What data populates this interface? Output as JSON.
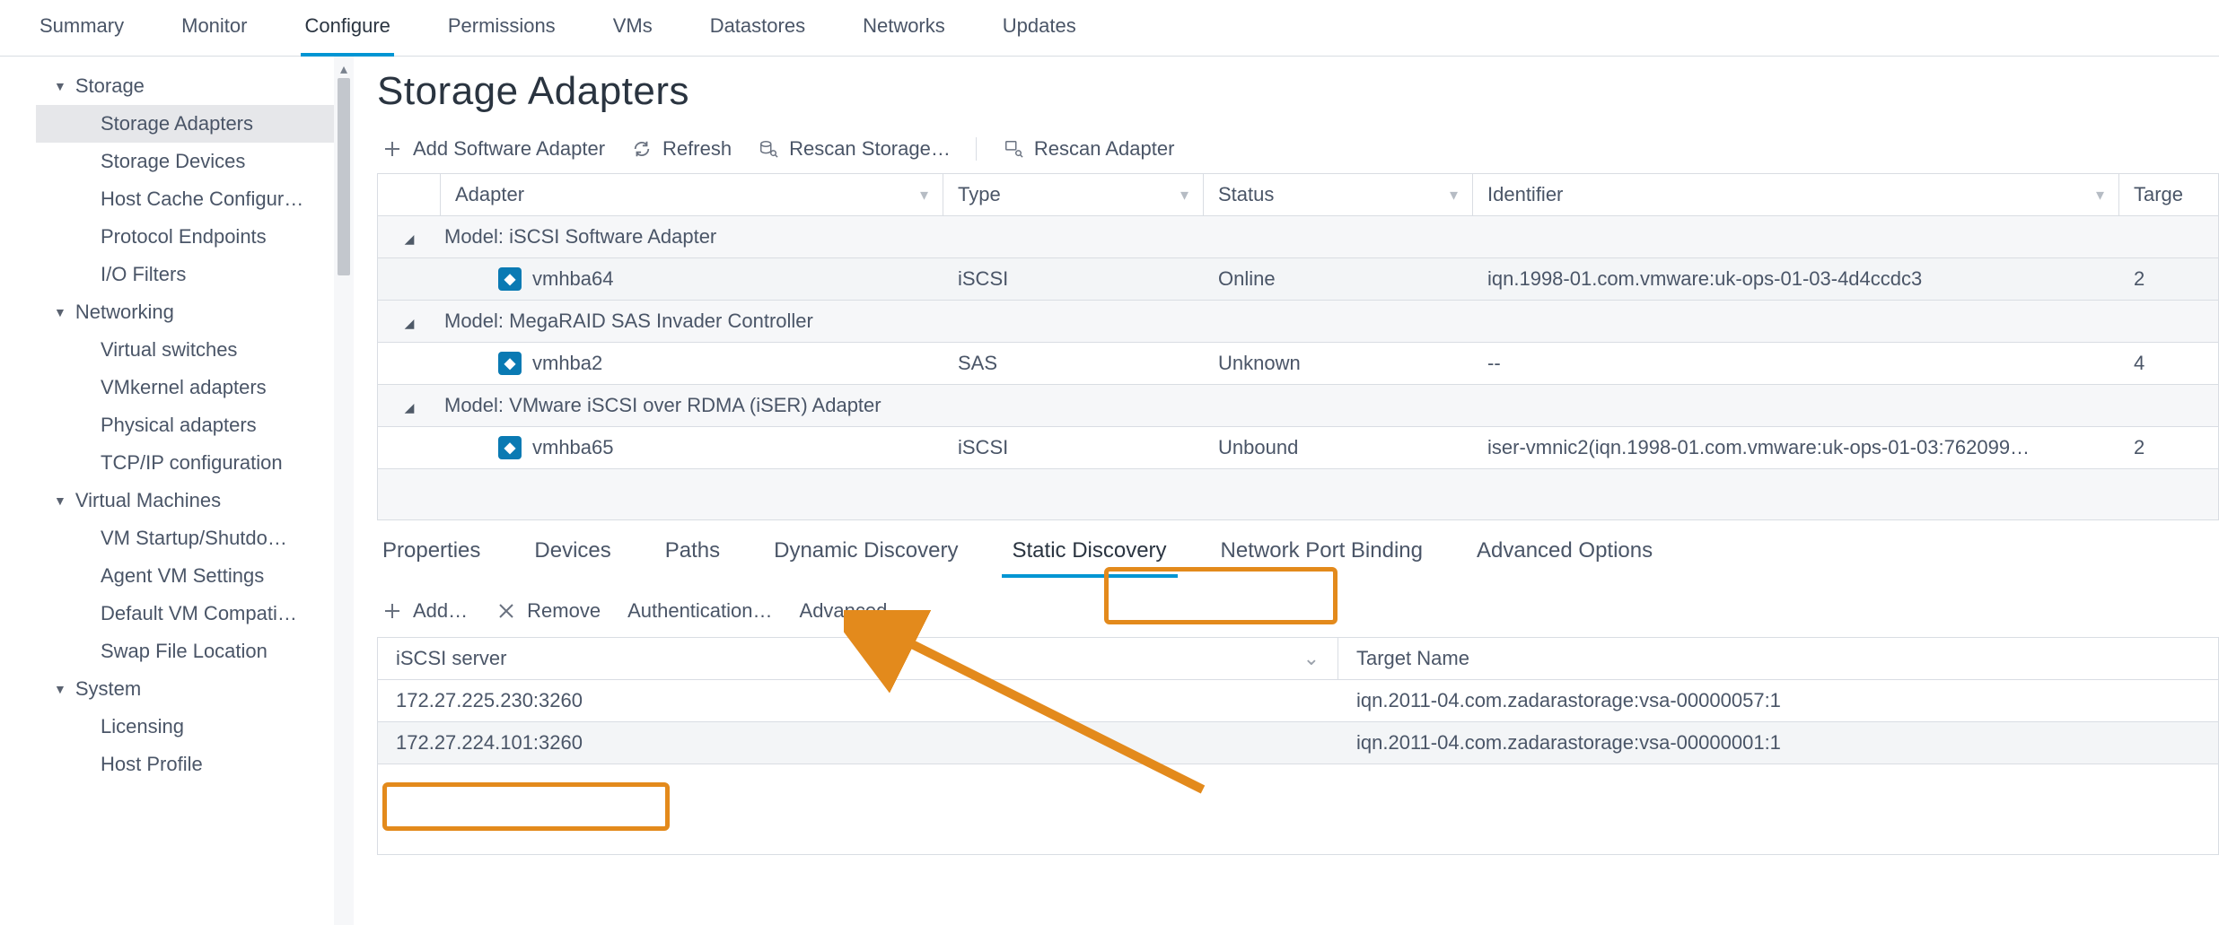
{
  "topTabs": {
    "summary": "Summary",
    "monitor": "Monitor",
    "configure": "Configure",
    "permissions": "Permissions",
    "vms": "VMs",
    "datastores": "Datastores",
    "networks": "Networks",
    "updates": "Updates"
  },
  "sidebar": {
    "storage": {
      "label": "Storage",
      "items": {
        "adapters": "Storage Adapters",
        "devices": "Storage Devices",
        "hostcache": "Host Cache Configur…",
        "protoep": "Protocol Endpoints",
        "iofilters": "I/O Filters"
      }
    },
    "networking": {
      "label": "Networking",
      "items": {
        "vswitches": "Virtual switches",
        "vmkernel": "VMkernel adapters",
        "physical": "Physical adapters",
        "tcpip": "TCP/IP configuration"
      }
    },
    "vms": {
      "label": "Virtual Machines",
      "items": {
        "startup": "VM Startup/Shutdo…",
        "agent": "Agent VM Settings",
        "compat": "Default VM Compati…",
        "swap": "Swap File Location"
      }
    },
    "system": {
      "label": "System",
      "items": {
        "licensing": "Licensing",
        "hostprofile": "Host Profile"
      }
    }
  },
  "page": {
    "title": "Storage Adapters"
  },
  "toolbar": {
    "addSoftware": "Add Software Adapter",
    "refresh": "Refresh",
    "rescanStorage": "Rescan Storage…",
    "rescanAdapter": "Rescan Adapter"
  },
  "adapters": {
    "headers": {
      "adapter": "Adapter",
      "type": "Type",
      "status": "Status",
      "identifier": "Identifier",
      "targets": "Targe"
    },
    "groups": [
      {
        "model": "Model: iSCSI Software Adapter",
        "rows": [
          {
            "name": "vmhba64",
            "type": "iSCSI",
            "status": "Online",
            "identifier": "iqn.1998-01.com.vmware:uk-ops-01-03-4d4ccdc3",
            "targets": "2"
          }
        ]
      },
      {
        "model": "Model: MegaRAID SAS Invader Controller",
        "rows": [
          {
            "name": "vmhba2",
            "type": "SAS",
            "status": "Unknown",
            "identifier": "--",
            "targets": "4"
          }
        ]
      },
      {
        "model": "Model: VMware iSCSI over RDMA (iSER) Adapter",
        "rows": [
          {
            "name": "vmhba65",
            "type": "iSCSI",
            "status": "Unbound",
            "identifier": "iser-vmnic2(iqn.1998-01.com.vmware:uk-ops-01-03:762099…",
            "targets": "2"
          }
        ]
      }
    ]
  },
  "detailTabs": {
    "properties": "Properties",
    "devices": "Devices",
    "paths": "Paths",
    "dynamic": "Dynamic Discovery",
    "static": "Static Discovery",
    "portBinding": "Network Port Binding",
    "advanced": "Advanced Options"
  },
  "discoveryToolbar": {
    "add": "Add…",
    "remove": "Remove",
    "auth": "Authentication…",
    "advanced": "Advanced…"
  },
  "iscsi": {
    "headers": {
      "server": "iSCSI server",
      "target": "Target Name"
    },
    "rows": [
      {
        "server": "172.27.225.230:3260",
        "target": "iqn.2011-04.com.zadarastorage:vsa-00000057:1"
      },
      {
        "server": "172.27.224.101:3260",
        "target": "iqn.2011-04.com.zadarastorage:vsa-00000001:1"
      }
    ]
  }
}
